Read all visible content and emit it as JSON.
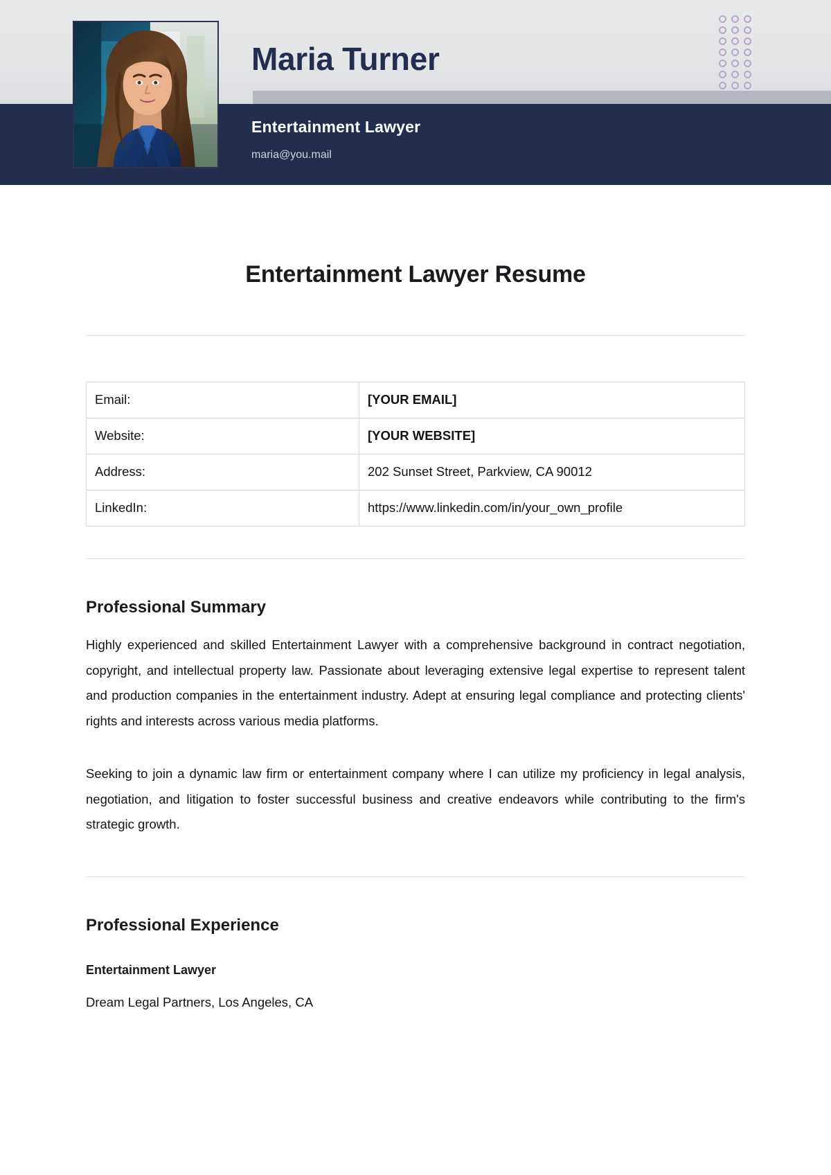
{
  "header": {
    "name": "Maria Turner",
    "job_title": "Entertainment Lawyer",
    "email": "maria@you.mail",
    "portrait_alt": "portrait-photo",
    "colors": {
      "navy": "#232e4e",
      "header_gray": "#e4e5e7",
      "accent_bar": "#b3b7c2",
      "dot": "#b9a6c4"
    },
    "decoration": {
      "dot_grid_columns": 3,
      "dot_grid_rows": 7
    }
  },
  "document": {
    "title": "Entertainment Lawyer Resume"
  },
  "contact": {
    "rows": [
      {
        "label": "Email:",
        "value": "[YOUR EMAIL]",
        "bold": true
      },
      {
        "label": "Website:",
        "value": "[YOUR WEBSITE]",
        "bold": true
      },
      {
        "label": "Address:",
        "value": "202 Sunset Street, Parkview, CA 90012",
        "bold": false
      },
      {
        "label": "LinkedIn:",
        "value": "https://www.linkedin.com/in/your_own_profile",
        "bold": false
      }
    ]
  },
  "summary": {
    "heading": "Professional Summary",
    "paragraph_1": "Highly experienced and skilled Entertainment Lawyer with a comprehensive background in contract negotiation, copyright, and intellectual property law. Passionate about leveraging extensive legal expertise to represent talent and production companies in the entertainment industry. Adept at ensuring legal compliance and protecting clients' rights and interests across various media platforms.",
    "paragraph_2": "Seeking to join a dynamic law firm or entertainment company where I can utilize my proficiency in legal analysis, negotiation, and litigation to foster successful business and creative endeavors while contributing to the firm's strategic growth."
  },
  "experience": {
    "heading": "Professional Experience",
    "entries": [
      {
        "role": "Entertainment Lawyer",
        "company": "Dream Legal Partners, Los Angeles, CA"
      }
    ]
  }
}
